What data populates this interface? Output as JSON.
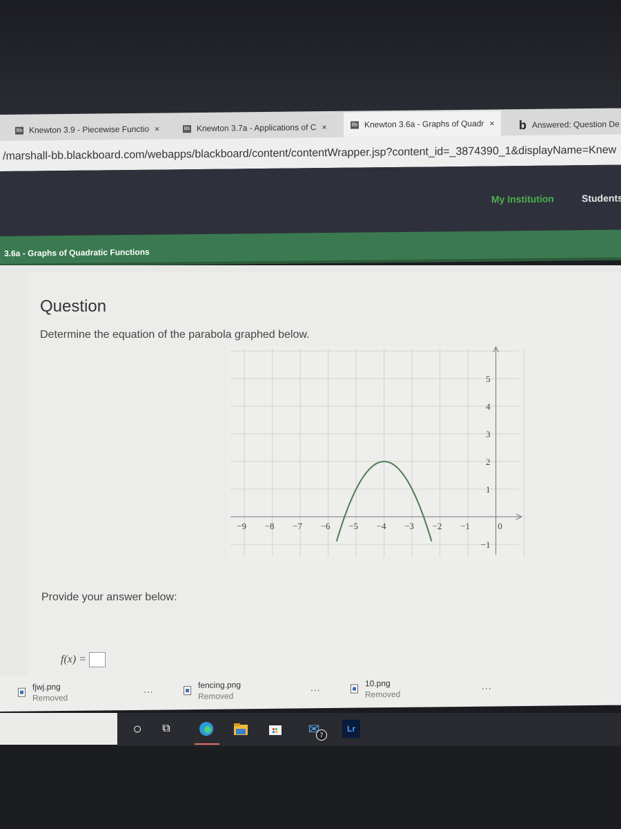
{
  "browser": {
    "tabs": [
      {
        "label": "Knewton 3.9 - Piecewise Functio",
        "icon": "blackboard-icon",
        "active": false
      },
      {
        "label": "Knewton 3.7a - Applications of C",
        "icon": "blackboard-icon",
        "active": false
      },
      {
        "label": "Knewton 3.6a - Graphs of Quadr",
        "icon": "blackboard-icon",
        "active": true
      },
      {
        "label": "Answered: Question De",
        "icon": "bartleby-icon",
        "active": false
      }
    ],
    "close_glyph": "×",
    "url": "/marshall-bb.blackboard.com/webapps/blackboard/content/contentWrapper.jsp?content_id=_3874390_1&displayName=Knew"
  },
  "header": {
    "nav": [
      {
        "label": "My Institution",
        "color": "#4caf50"
      },
      {
        "label": "Students",
        "color": "#e6e6e6"
      }
    ]
  },
  "breadcrumb": {
    "title": "3.6a - Graphs of Quadratic Functions"
  },
  "question": {
    "heading": "Question",
    "prompt": "Determine the equation of the parabola graphed below.",
    "provide_label": "Provide your answer below:",
    "answer_prefix": "f(x) =",
    "answer_value": ""
  },
  "chart_data": {
    "type": "line",
    "title": "",
    "xlabel": "",
    "ylabel": "",
    "xlim": [
      -9,
      0
    ],
    "ylim": [
      -1,
      5
    ],
    "x_ticks": [
      -9,
      -8,
      -7,
      -6,
      -5,
      -4,
      -3,
      -2,
      -1,
      0
    ],
    "y_ticks": [
      5,
      4,
      3,
      2,
      1,
      -1
    ],
    "grid": true,
    "series": [
      {
        "name": "parabola",
        "equation_form": "vertex",
        "vertex": [
          -4,
          2
        ],
        "a": -1,
        "x_range": [
          -5.7,
          -2.3
        ],
        "color": "#4f7a55"
      }
    ]
  },
  "downloads": [
    {
      "name": "fjwj.png",
      "status": "Removed"
    },
    {
      "name": "fencing.png",
      "status": "Removed"
    },
    {
      "name": "10.png",
      "status": "Removed"
    }
  ],
  "downloads_more": "...",
  "taskbar": {
    "items": [
      {
        "name": "cortana-search-icon",
        "glyph": "○"
      },
      {
        "name": "task-view-icon",
        "glyph": "⧉"
      },
      {
        "name": "edge-icon",
        "glyph": ""
      },
      {
        "name": "file-explorer-icon",
        "glyph": ""
      },
      {
        "name": "store-icon",
        "glyph": ""
      },
      {
        "name": "mail-icon",
        "glyph": "✉",
        "badge": "7"
      },
      {
        "name": "lightroom-icon",
        "glyph": "Lr"
      }
    ]
  }
}
